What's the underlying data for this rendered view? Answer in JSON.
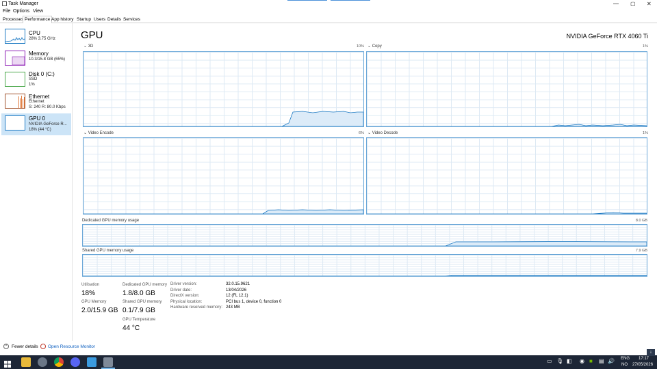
{
  "window": {
    "title": "Task Manager",
    "controls": {
      "minimize": "—",
      "maximize": "▢",
      "close": "✕"
    }
  },
  "menu": [
    "File",
    "Options",
    "View"
  ],
  "tabs": [
    "Processes",
    "Performance",
    "App history",
    "Startup",
    "Users",
    "Details",
    "Services"
  ],
  "active_tab": "Performance",
  "sidebar": [
    {
      "title": "CPU",
      "sub1": "28% 3.75 GHz",
      "sub2": "",
      "color": "#1a78c2"
    },
    {
      "title": "Memory",
      "sub1": "10.3/15.8 GB (65%)",
      "sub2": "",
      "color": "#8b1ab3"
    },
    {
      "title": "Disk 0 (C:)",
      "sub1": "SSD",
      "sub2": "1%",
      "color": "#4aa84a"
    },
    {
      "title": "Ethernet",
      "sub1": "Ethernet",
      "sub2": "S: 240 R: 80.0 Kbps",
      "color": "#a0522d"
    },
    {
      "title": "GPU 0",
      "sub1": "NVIDIA GeForce R...",
      "sub2": "18% (44 °C)",
      "color": "#1a78c2"
    }
  ],
  "main": {
    "title": "GPU",
    "gpu_name": "NVIDIA GeForce RTX 4060 Ti",
    "panels": [
      {
        "label": "3D",
        "value": "10%"
      },
      {
        "label": "Copy",
        "value": "1%"
      },
      {
        "label": "Video Encode",
        "value": "6%"
      },
      {
        "label": "Video Decode",
        "value": "1%"
      }
    ],
    "dedicated_memory": {
      "label": "Dedicated GPU memory usage",
      "max": "8.0 GB"
    },
    "shared_memory": {
      "label": "Shared GPU memory usage",
      "max": "7.9 GB"
    }
  },
  "stats": {
    "utilisation": {
      "label": "Utilisation",
      "value": "18%"
    },
    "gpu_memory": {
      "label": "GPU Memory",
      "value": "2.0/15.9 GB"
    },
    "dedicated": {
      "label": "Dedicated GPU memory",
      "value": "1.8/8.0 GB"
    },
    "shared": {
      "label": "Shared GPU memory",
      "value": "0.1/7.9 GB"
    },
    "temperature": {
      "label": "GPU Temperature",
      "value": "44 °C"
    }
  },
  "info": [
    {
      "label": "Driver version:",
      "value": "32.0.15.9621"
    },
    {
      "label": "Driver date:",
      "value": "13/04/2026"
    },
    {
      "label": "DirectX version:",
      "value": "12 (FL 12.1)"
    },
    {
      "label": "Physical location:",
      "value": "PCI bus 1, device 0, function 0"
    },
    {
      "label": "Hardware reserved memory:",
      "value": "243 MB"
    }
  ],
  "footer": {
    "fewer_details": "Fewer details",
    "open_monitor": "Open Resource Monitor"
  },
  "taskbar": {
    "lang_top": "ENG",
    "lang_bottom": "NO",
    "time": "17:17",
    "date": "27/05/2026"
  }
}
